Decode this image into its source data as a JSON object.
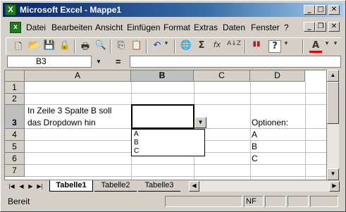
{
  "window": {
    "title": "Microsoft Excel - Mappe1",
    "app_icon": "X",
    "controls": [
      "_",
      "□",
      "✕"
    ]
  },
  "menubar": {
    "doc_icon": "x",
    "items": [
      "Datei",
      "Bearbeiten",
      "Ansicht",
      "Einfügen",
      "Format",
      "Extras",
      "Daten",
      "Fenster",
      "?"
    ],
    "doc_controls": [
      "_",
      "❐",
      "✕"
    ]
  },
  "toolbar": {
    "icons": [
      "new-icon",
      "open-icon",
      "save-icon",
      "permission-icon",
      "print-icon",
      "print-preview-icon",
      "copy-icon",
      "paste-icon",
      "undo-icon",
      "hyperlink-icon",
      "autosum-icon",
      "function-icon",
      "sort-icon",
      "chart-icon",
      "help-icon",
      "font-color-icon"
    ],
    "glyphs": {
      "new": "🗋",
      "open": "📂",
      "save": "💾",
      "permission": "🔒",
      "print": "🖶",
      "preview": "🔍",
      "copy": "⎘",
      "paste": "📋",
      "undo": "↶",
      "undo_arrow": "▾",
      "hyperlink": "🌐",
      "autosum": "Σ",
      "function": "fx",
      "sort": "A↓Z",
      "chart": "▮▮",
      "help": "?",
      "font_color": "A",
      "more": "▾"
    }
  },
  "formula_bar": {
    "name_box": "B3",
    "equals": "=",
    "formula": ""
  },
  "sheet": {
    "columns": [
      "A",
      "B",
      "C",
      "D"
    ],
    "rows": [
      "1",
      "2",
      "3",
      "4",
      "5",
      "6",
      "7"
    ],
    "active_cell": "B3",
    "cells": {
      "A3_line1": "In Zeile 3 Spalte B soll",
      "A3_line2": "das Dropdown hin",
      "D3": "Optionen:",
      "D4": "A",
      "D5": "B",
      "D6": "C"
    },
    "dropdown_options": [
      "A",
      "B",
      "C"
    ]
  },
  "tabs": {
    "items": [
      "Tabelle1",
      "Tabelle2",
      "Tabelle3"
    ],
    "active": "Tabelle1"
  },
  "status": {
    "text": "Bereit",
    "num_lock": "NF"
  }
}
